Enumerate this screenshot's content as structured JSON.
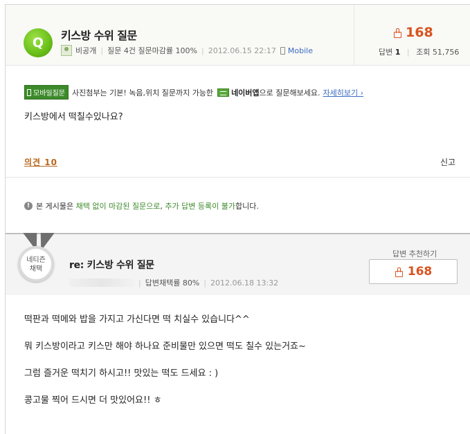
{
  "question": {
    "badge": "Q",
    "title": "키스방 수위 질문",
    "author": "비공개",
    "stats_text": "질문 4건 질문마감률 100%",
    "date": "2012.06.15 22:17",
    "mobile_label": "Mobile",
    "likes": "168",
    "answers_label": "답변",
    "answers_count": "1",
    "views_label": "조회",
    "views_count": "51,756",
    "body": "키스방에서 떡칠수있나요?",
    "opinion_link": "의견 10",
    "report_link": "신고"
  },
  "notice": {
    "mobile_badge": "모바일질문",
    "text_before": "사진첨부는 기본! 녹음,위치 질문까지 가능한",
    "app_name": "네이버앱",
    "text_after": "으로 질문해보세요.",
    "detail_link": "자세히보기 ›"
  },
  "closed_note": {
    "part1": "본 게시물은",
    "part2": "채택 없이 마감된 질문으로",
    "part3": ",",
    "part4": "추가 답변 등록이 불가",
    "part5": "합니다."
  },
  "answer": {
    "medal_line1": "네티즌",
    "medal_line2": "채택",
    "title": "re: 키스방 수위 질문",
    "adopt_rate": "답변채택률 80%",
    "date": "2012.06.18 13:32",
    "recommend_label": "답변 추천하기",
    "likes": "168",
    "paragraphs": [
      "떡판과 떡메와 밥을 가지고 가신다면 떡 치실수 있습니다^^",
      "뭐 키스방이라고 키스만 해야 하나요 준비물만 있으면 떡도 칠수 있는거죠~",
      "그럼 즐거운 떡치기 하시고!! 맛있는 떡도 드세요 : )",
      "콩고물 찍어 드시면 더 맛있어요!! ㅎ"
    ]
  },
  "colors": {
    "accent_orange": "#d9531e",
    "green": "#3d8a2a",
    "link_blue": "#3a6bbf"
  }
}
